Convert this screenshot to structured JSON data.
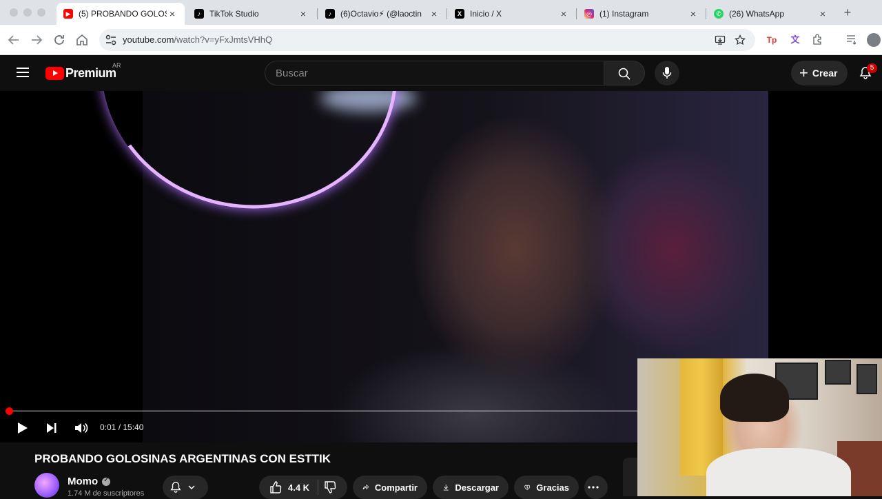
{
  "browser": {
    "tabs": [
      {
        "title": "(5) PROBANDO GOLOS",
        "close": "×",
        "active": true,
        "icon": "youtube-icon",
        "color": "#ff0000"
      },
      {
        "title": "TikTok Studio",
        "close": "×",
        "active": false,
        "icon": "tiktok-icon",
        "color": "#000000"
      },
      {
        "title": "(6)Octavio⚡ (@laoctin",
        "close": "×",
        "active": false,
        "icon": "tiktok-icon",
        "color": "#000000"
      },
      {
        "title": "Inicio / X",
        "close": "×",
        "active": false,
        "icon": "x-icon",
        "color": "#000000"
      },
      {
        "title": "(1) Instagram",
        "close": "×",
        "active": false,
        "icon": "instagram-icon",
        "color": "#d62976"
      },
      {
        "title": "(26) WhatsApp",
        "close": "×",
        "active": false,
        "icon": "whatsapp-icon",
        "color": "#25d366"
      }
    ],
    "new_tab": "+",
    "url_host": "youtube.com",
    "url_path": "/watch?v=yFxJmtsVHhQ"
  },
  "youtube": {
    "brand": "Premium",
    "region": "AR",
    "search_placeholder": "Buscar",
    "create_label": "Crear",
    "notifications_count": "5"
  },
  "player": {
    "time_current": "0:01",
    "time_total": "15:40",
    "time_display": "0:01 / 15:40",
    "progress": 0.001
  },
  "video": {
    "title": "PROBANDO GOLOSINAS ARGENTINAS CON ESTTIK",
    "channel": "Momo",
    "subscribers": "1.74 M de suscriptores",
    "likes": "4.4 K",
    "share_label": "Compartir",
    "download_label": "Descargar",
    "thanks_label": "Gracias"
  },
  "colors": {
    "accent": "#ff0000",
    "page_bg": "#0f0f0f",
    "pill_bg": "#272727"
  }
}
